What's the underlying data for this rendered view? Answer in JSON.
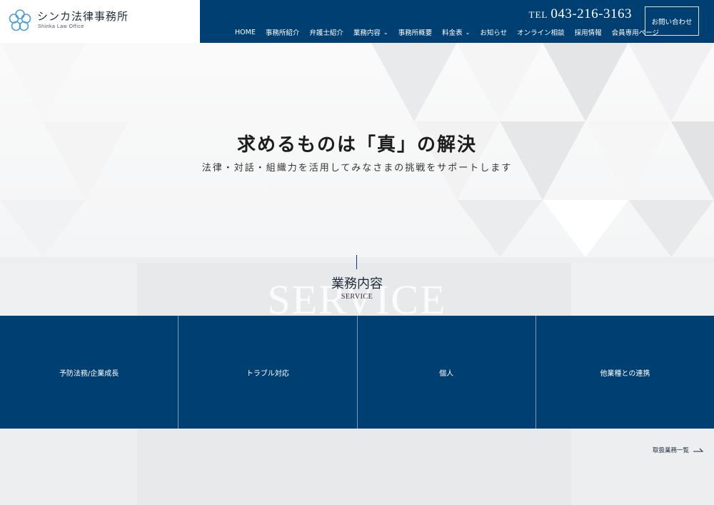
{
  "header": {
    "logo_text": "シンカ法律事務所",
    "logo_sub": "Shinka Law Office",
    "logo_icon": "flower-logo-icon",
    "tel_label": "TEL",
    "tel_number": "043-216-3163",
    "contact_label": "お問い合わせ",
    "nav": [
      {
        "label": "HOME",
        "dropdown": false
      },
      {
        "label": "事務所紹介",
        "dropdown": false
      },
      {
        "label": "弁護士紹介",
        "dropdown": false
      },
      {
        "label": "業務内容",
        "dropdown": true
      },
      {
        "label": "事務所概要",
        "dropdown": false
      },
      {
        "label": "料金表",
        "dropdown": true
      },
      {
        "label": "お知らせ",
        "dropdown": false
      },
      {
        "label": "オンライン相談",
        "dropdown": false
      },
      {
        "label": "採用情報",
        "dropdown": false
      },
      {
        "label": "会員専用ページ",
        "dropdown": false
      }
    ]
  },
  "hero": {
    "title": "求めるものは「真」の解決",
    "subtitle": "法律・対話・組織力を活用してみなさまの挑戦をサポートします"
  },
  "service": {
    "title": "業務内容",
    "english": "SERVICE",
    "background_word": "SERVICE",
    "cards": [
      "予防法務/企業成長",
      "トラブル対応",
      "個人",
      "他業種との連携"
    ],
    "more_label": "取扱業務一覧"
  },
  "colors": {
    "brand_navy": "#003f72",
    "logo_blue": "#4a9fd6"
  }
}
